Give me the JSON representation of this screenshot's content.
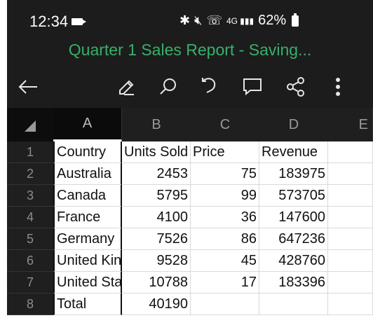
{
  "status": {
    "time": "12:34",
    "battery_percent": "62%",
    "icons": [
      "bluetooth-icon",
      "mute-icon",
      "wifi-call-icon",
      "signal-icon",
      "battery-icon"
    ]
  },
  "title": "Quarter 1 Sales Report - Saving...",
  "toolbar": {
    "icons": [
      "back-arrow-icon",
      "edit-pen-icon",
      "search-icon",
      "undo-icon",
      "comment-icon",
      "share-icon",
      "more-icon"
    ]
  },
  "sheet": {
    "columns": [
      "A",
      "B",
      "C",
      "D",
      "E"
    ],
    "rows": [
      "1",
      "2",
      "3",
      "4",
      "5",
      "6",
      "7",
      "8"
    ],
    "cells": [
      [
        "Country",
        "Units Sold",
        "Price",
        "Revenue",
        ""
      ],
      [
        "Australia",
        "2453",
        "75",
        "183975",
        ""
      ],
      [
        "Canada",
        "5795",
        "99",
        "573705",
        ""
      ],
      [
        "France",
        "4100",
        "36",
        "147600",
        ""
      ],
      [
        "Germany",
        "7526",
        "86",
        "647236",
        ""
      ],
      [
        "United Kingdom",
        "9528",
        "45",
        "428760",
        ""
      ],
      [
        "United States",
        "10788",
        "17",
        "183396",
        ""
      ],
      [
        "Total",
        "40190",
        "",
        "",
        ""
      ]
    ]
  },
  "colors": {
    "title": "#38b06a",
    "dark_bg": "#1c1c1c"
  }
}
